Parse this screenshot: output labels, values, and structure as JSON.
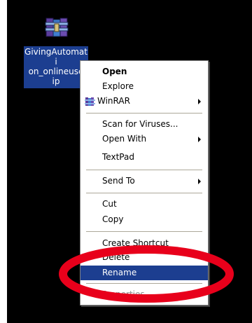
{
  "desktop": {
    "icon": {
      "name": "winrar-archive-icon",
      "label_lines": [
        "GivingAutomati",
        "on_onlineuse",
        "ip"
      ]
    }
  },
  "context_menu": {
    "items": [
      {
        "label": "Open",
        "bold": true,
        "submenu": false
      },
      {
        "label": "Explore",
        "bold": false,
        "submenu": false
      },
      {
        "label": "WinRAR",
        "bold": false,
        "submenu": true,
        "icon": "winrar-icon"
      },
      {
        "label": "Scan for Viruses...",
        "bold": false,
        "submenu": false
      },
      {
        "label": "Open With",
        "bold": false,
        "submenu": true
      },
      {
        "label": "TextPad",
        "bold": false,
        "submenu": false
      },
      {
        "label": "Send To",
        "bold": false,
        "submenu": true
      },
      {
        "label": "Cut",
        "bold": false,
        "submenu": false
      },
      {
        "label": "Copy",
        "bold": false,
        "submenu": false
      },
      {
        "label": "Create Shortcut",
        "bold": false,
        "submenu": false
      },
      {
        "label": "Delete",
        "bold": false,
        "submenu": false
      },
      {
        "label": "Rename",
        "bold": false,
        "submenu": false,
        "selected": true
      },
      {
        "label": "Properties",
        "bold": false,
        "submenu": false
      }
    ]
  },
  "annotation": {
    "shape": "ellipse",
    "color": "#e8001b",
    "target": "Rename"
  },
  "colors": {
    "background": "#000000",
    "selection": "#1c3e90",
    "menu_background": "#ffffff"
  }
}
